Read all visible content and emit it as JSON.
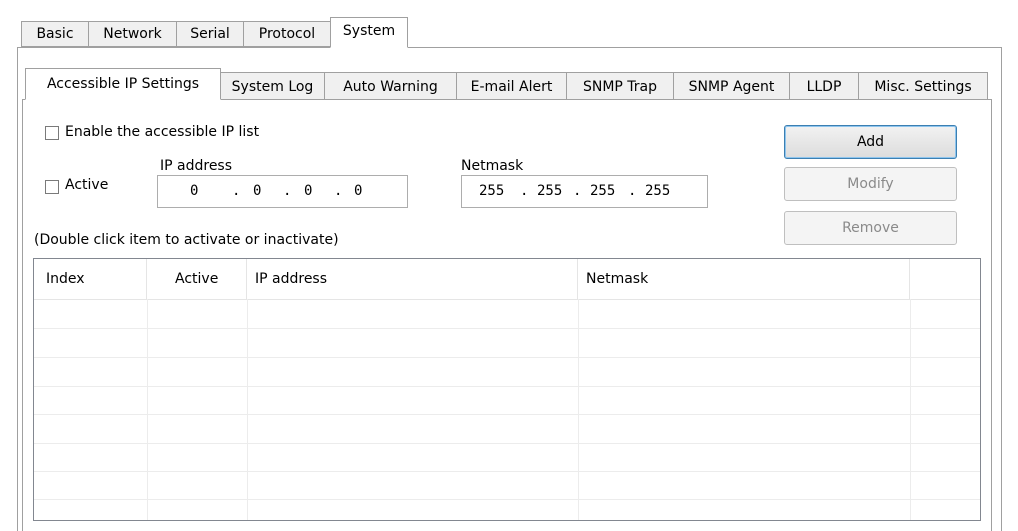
{
  "top_tabs": [
    "Basic",
    "Network",
    "Serial",
    "Protocol",
    "System"
  ],
  "sub_tabs": [
    "Accessible IP Settings",
    "System Log",
    "Auto Warning",
    "E-mail Alert",
    "SNMP Trap",
    "SNMP Agent",
    "LLDP",
    "Misc. Settings"
  ],
  "form": {
    "enable_label": "Enable the accessible IP list",
    "active_label": "Active",
    "ip_label": "IP address",
    "netmask_label": "Netmask",
    "ip_octets": [
      "0",
      "0",
      "0",
      "0"
    ],
    "netmask_octets": [
      "255",
      "255",
      "255",
      "255"
    ],
    "dot": ".",
    "hint": "(Double click item to activate or inactivate)"
  },
  "buttons": {
    "add": "Add",
    "modify": "Modify",
    "remove": "Remove"
  },
  "table": {
    "columns": [
      "Index",
      "Active",
      "IP address",
      "Netmask"
    ]
  }
}
